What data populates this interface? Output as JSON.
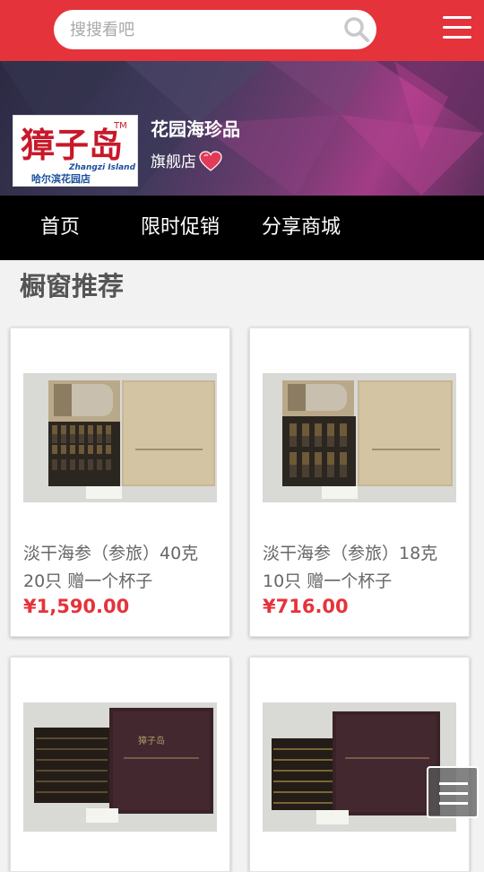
{
  "search": {
    "placeholder": "搜搜看吧"
  },
  "store": {
    "logo_text": "獐子岛",
    "logo_sub_en": "Zhangzi Island",
    "logo_sub_cn": "哈尔滨花园店",
    "logo_tm": "TM",
    "name": "花园海珍品",
    "type": "旗舰店"
  },
  "nav": [
    {
      "label": "首页"
    },
    {
      "label": "限时促销"
    },
    {
      "label": "分享商城"
    }
  ],
  "section": {
    "title": "橱窗推荐"
  },
  "products": [
    {
      "title_line1": "淡干海参（参旅）40克",
      "title_line2": "20只 赠一个杯子",
      "price": "¥1,590.00"
    },
    {
      "title_line1": "淡干海参（参旅）18克",
      "title_line2": "10只 赠一个杯子",
      "price": "¥716.00"
    },
    {
      "title_line1": "",
      "title_line2": "",
      "price": ""
    },
    {
      "title_line1": "",
      "title_line2": "",
      "price": ""
    }
  ],
  "colors": {
    "brand": "#e5333b",
    "nav_bg": "#000000",
    "price": "#e5333b"
  }
}
